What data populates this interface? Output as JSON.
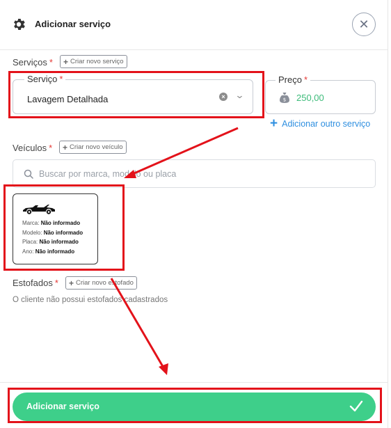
{
  "header": {
    "title": "Adicionar serviço"
  },
  "servicos": {
    "label": "Serviços",
    "required": "*",
    "create_chip": "Criar novo serviço",
    "servico_legend": "Serviço",
    "servico_value": "Lavagem Detalhada",
    "preco_legend": "Preço",
    "preco_value": "250,00",
    "add_other": "Adicionar outro serviço"
  },
  "veiculos": {
    "label": "Veículos",
    "required": "*",
    "create_chip": "Criar novo veículo",
    "search_placeholder": "Buscar por marca, modelo ou placa",
    "card": {
      "icon": "convertible-car-icon",
      "rows": [
        {
          "key": "Marca:",
          "value": "Não informado"
        },
        {
          "key": "Modelo:",
          "value": "Não informado"
        },
        {
          "key": "Placa:",
          "value": "Não informado"
        },
        {
          "key": "Ano:",
          "value": "Não informado"
        }
      ]
    }
  },
  "estofados": {
    "label": "Estofados",
    "required": "*",
    "create_chip": "Criar novo estofado",
    "empty_message": "O cliente não possui estofados cadastrados"
  },
  "footer": {
    "submit_label": "Adicionar serviço"
  },
  "colors": {
    "accent_green": "#3ecf8a",
    "link_blue": "#2f8fe0",
    "required_red": "#e53935",
    "annotation_red": "#e3121a"
  }
}
